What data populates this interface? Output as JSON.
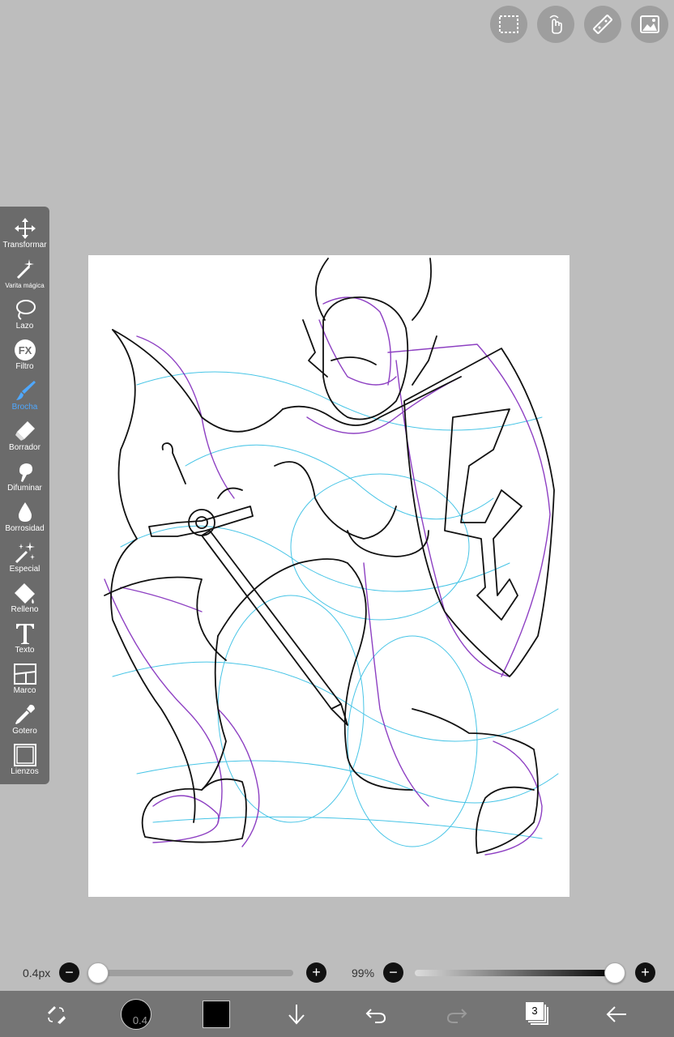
{
  "top_bar": {
    "buttons": [
      {
        "name": "selection",
        "icon": "dashed-rect-icon"
      },
      {
        "name": "gesture",
        "icon": "hand-pointer-icon"
      },
      {
        "name": "ruler",
        "icon": "ruler-icon"
      },
      {
        "name": "gallery",
        "icon": "image-icon"
      }
    ]
  },
  "toolbar": {
    "tools": [
      {
        "label": "Transformar",
        "icon": "move-arrows-icon"
      },
      {
        "label": "Varita mágica",
        "icon": "magic-wand-icon"
      },
      {
        "label": "Lazo",
        "icon": "lasso-icon"
      },
      {
        "label": "Filtro",
        "icon": "fx-icon"
      },
      {
        "label": "Brocha",
        "icon": "brush-icon",
        "active": true
      },
      {
        "label": "Borrador",
        "icon": "eraser-icon"
      },
      {
        "label": "Difuminar",
        "icon": "smudge-icon"
      },
      {
        "label": "Borrosidad",
        "icon": "blur-drop-icon"
      },
      {
        "label": "Especial",
        "icon": "special-sparkle-icon"
      },
      {
        "label": "Relleno",
        "icon": "fill-bucket-icon"
      },
      {
        "label": "Texto",
        "icon": "text-icon"
      },
      {
        "label": "Marco",
        "icon": "frame-icon"
      },
      {
        "label": "Gotero",
        "icon": "eyedropper-icon"
      },
      {
        "label": "Lienzos",
        "icon": "canvas-icon"
      }
    ]
  },
  "brush_size": {
    "label": "0.4px",
    "value_fraction": 0.0
  },
  "opacity": {
    "label": "99%",
    "value_fraction": 0.99
  },
  "bottom_bar": {
    "brush_preview_label": "0.4",
    "primary_color": "#000000",
    "layers_count": "3",
    "icons": [
      "brush-eraser-swap-icon",
      "brush-size-preview",
      "color-swatch",
      "download-arrow-icon",
      "undo-icon",
      "redo-icon",
      "layers-icon",
      "back-arrow-icon"
    ]
  },
  "colors": {
    "background": "#bdbdbd",
    "toolbar": "#6b6b6b",
    "active_tool": "#4fa8ff",
    "bottom_bar": "#757575",
    "sketch_purple": "#7a1fb8",
    "sketch_cyan": "#19b6e0"
  }
}
